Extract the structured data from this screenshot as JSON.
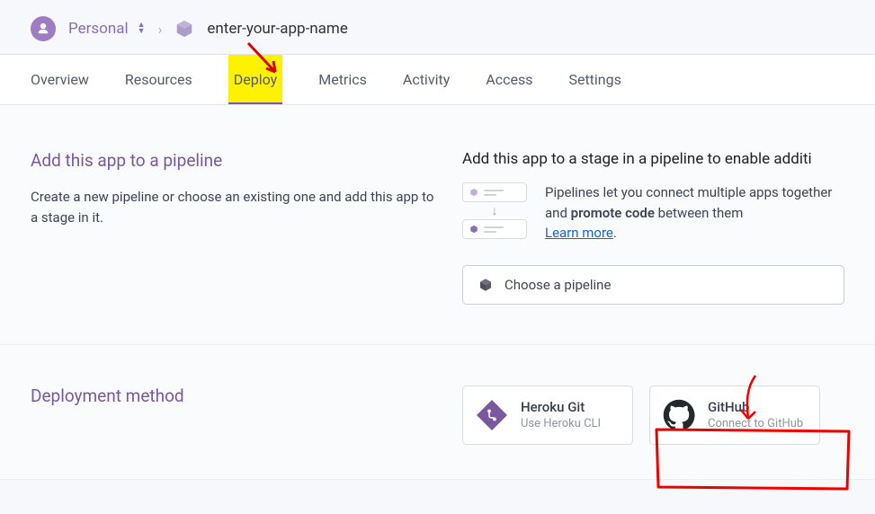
{
  "breadcrumb": {
    "personal_label": "Personal",
    "app_name": "enter-your-app-name"
  },
  "tabs": [
    {
      "label": "Overview"
    },
    {
      "label": "Resources"
    },
    {
      "label": "Deploy"
    },
    {
      "label": "Metrics"
    },
    {
      "label": "Activity"
    },
    {
      "label": "Access"
    },
    {
      "label": "Settings"
    }
  ],
  "pipeline_section": {
    "heading": "Add this app to a pipeline",
    "desc": "Create a new pipeline or choose an existing one and add this app to a stage in it.",
    "right_heading": "Add this app to a stage in a pipeline to enable additi",
    "info_text_1": "Pipelines let you connect multiple apps together and ",
    "info_bold": "promote code",
    "info_text_2": " between them",
    "learn_more": "Learn more",
    "dropdown_label": "Choose a pipeline"
  },
  "deploy_section": {
    "heading": "Deployment method",
    "methods": [
      {
        "title": "Heroku Git",
        "sub": "Use Heroku CLI"
      },
      {
        "title": "GitHub",
        "sub": "Connect to GitHub"
      }
    ]
  }
}
